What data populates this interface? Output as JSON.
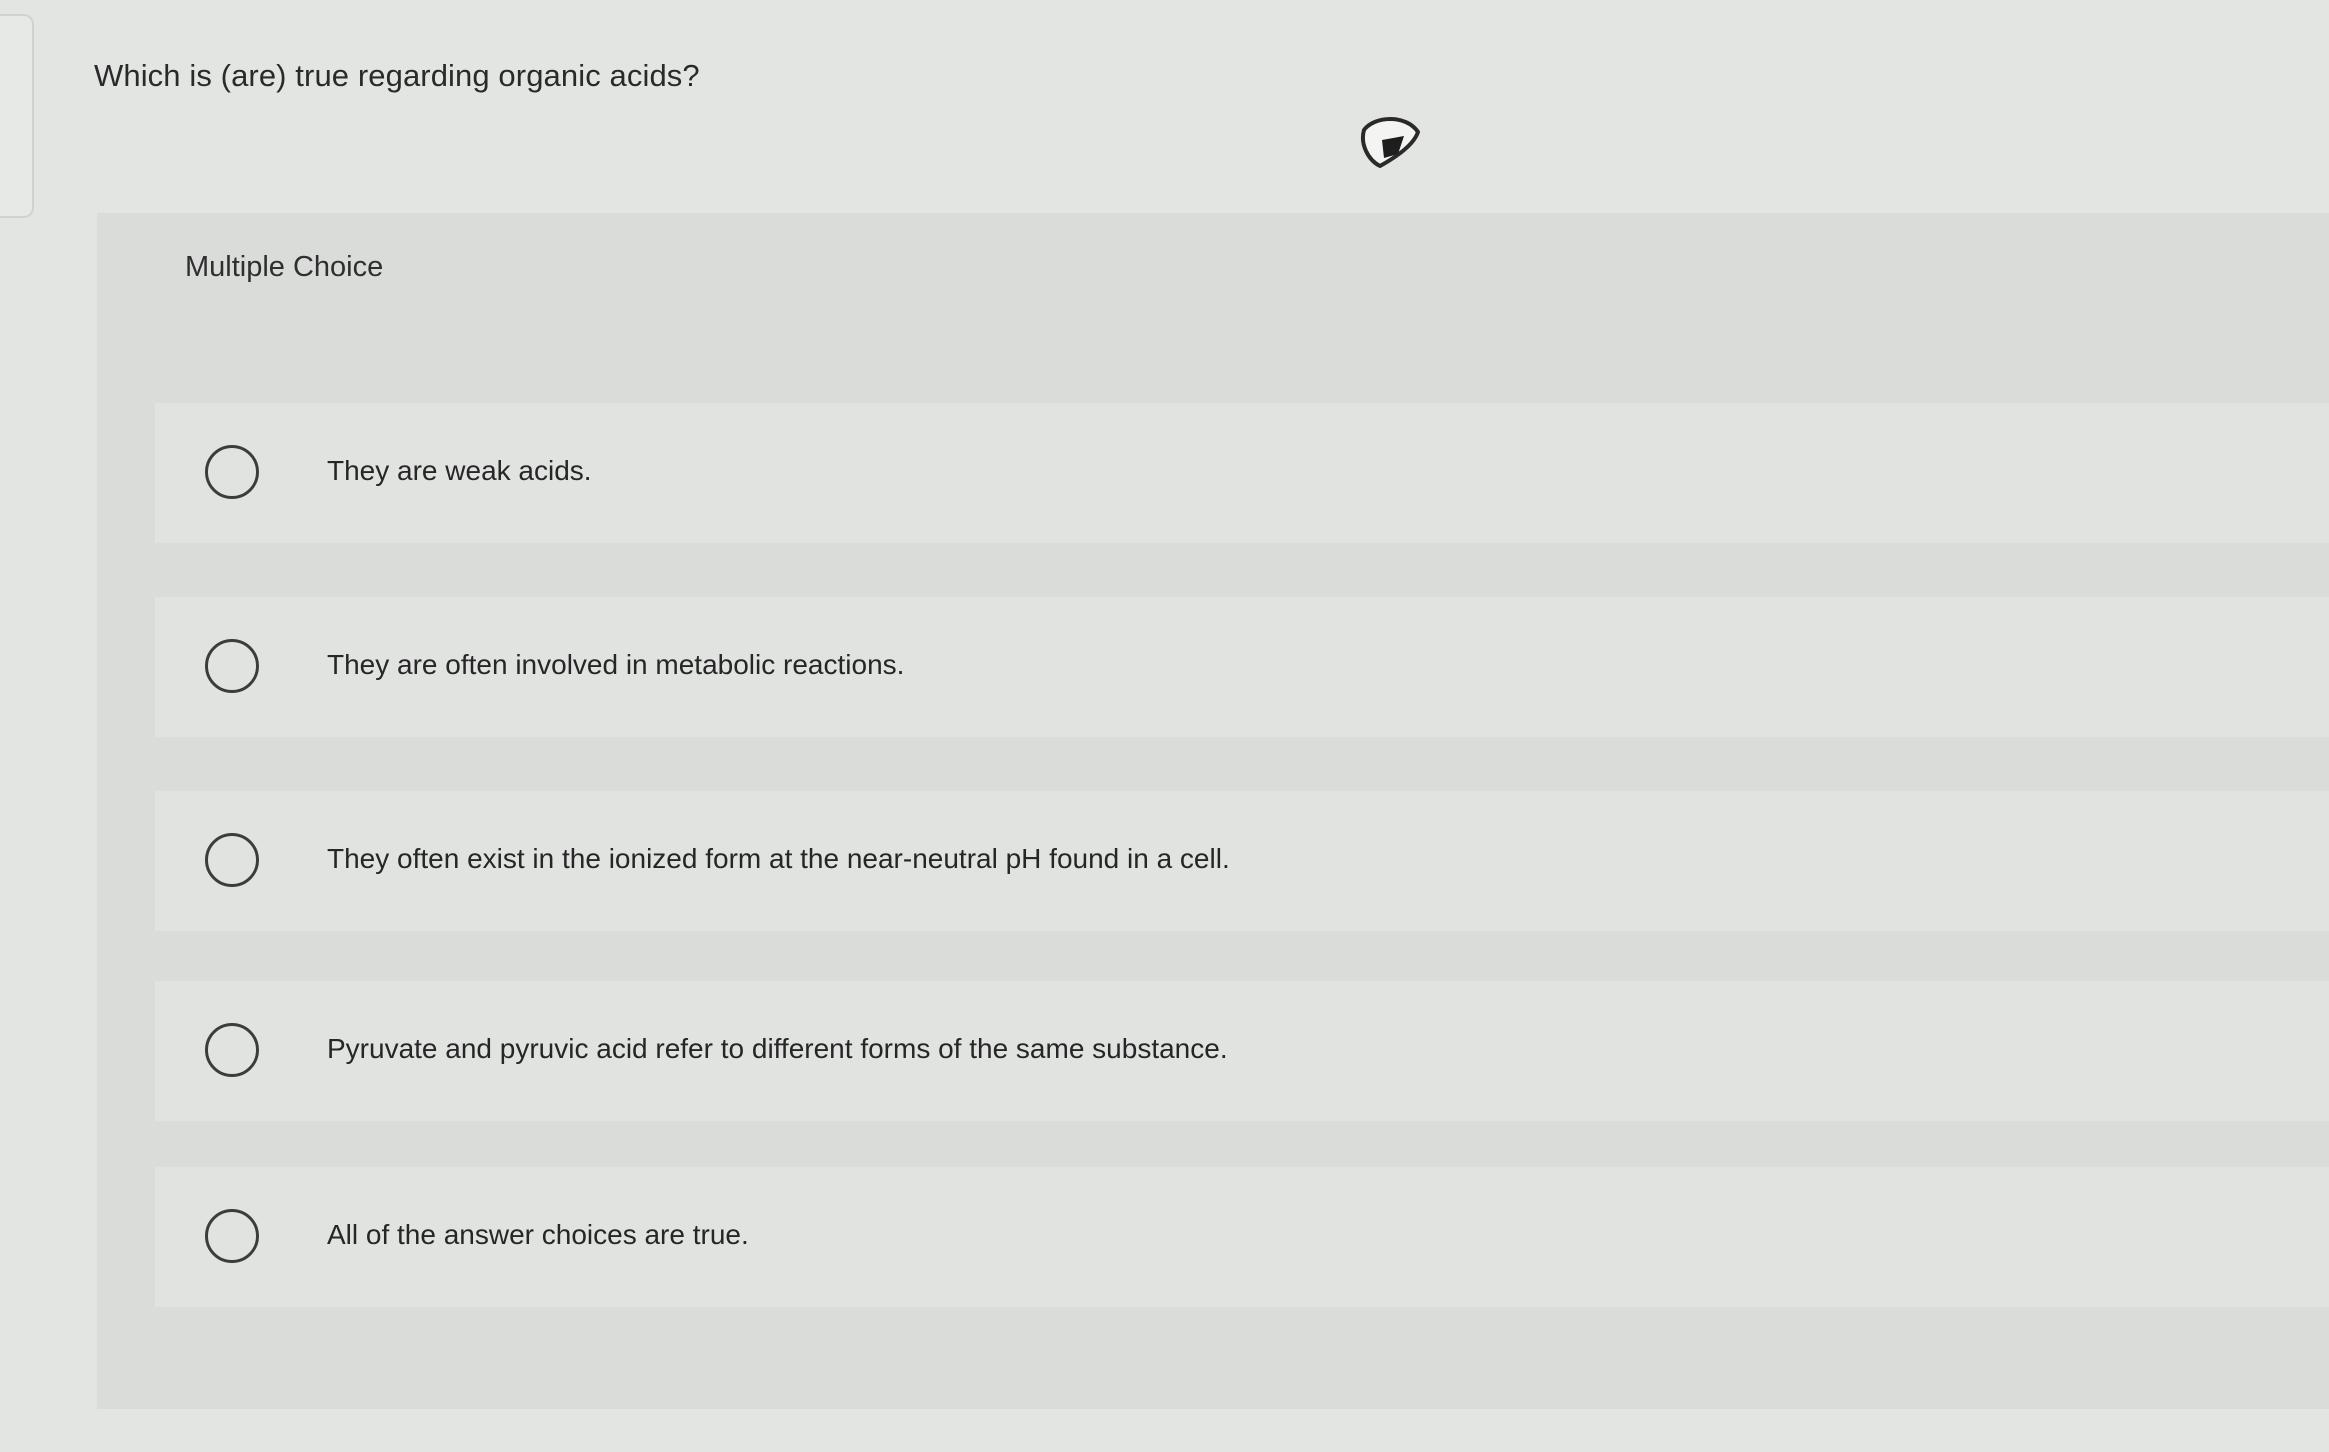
{
  "question": {
    "text": "Which is (are) true regarding organic acids?"
  },
  "question_type": {
    "label": "Multiple Choice"
  },
  "choices": [
    {
      "label": "They are weak acids.",
      "selected": false
    },
    {
      "label": "They are often involved in metabolic reactions.",
      "selected": false
    },
    {
      "label": "They often exist in the ionized form at the near-neutral pH found in a cell.",
      "selected": false
    },
    {
      "label": "Pyruvate and pyruvic acid refer to different forms of the same substance.",
      "selected": false
    },
    {
      "label": "All of the answer choices are true.",
      "selected": false
    }
  ],
  "icons": {
    "flag": "bookmark-flag-icon"
  },
  "colors": {
    "background": "#e3e5e3",
    "panel": "#dadcda",
    "choice_row": "#e1e3e1",
    "text": "#2b2b2b"
  }
}
